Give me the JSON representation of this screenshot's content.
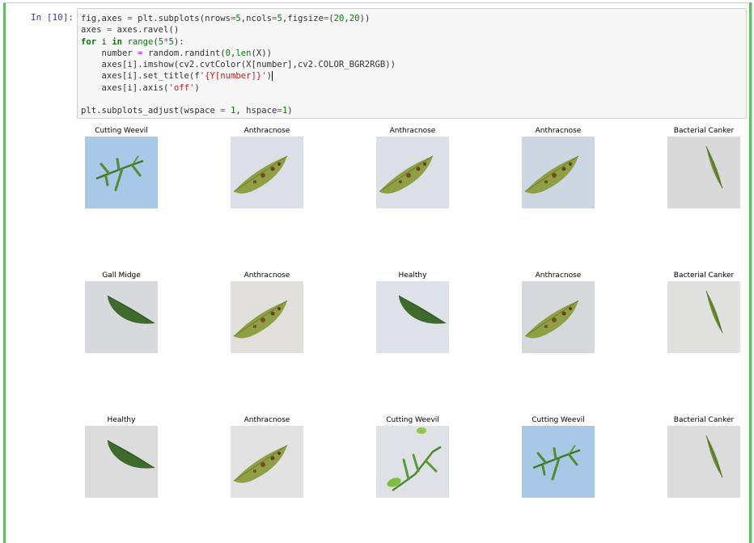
{
  "cell": {
    "prompt": "In [10]:",
    "code_lines": [
      "fig,axes = plt.subplots(nrows=5,ncols=5,figsize=(20,20))",
      "axes = axes.ravel()",
      "for i in range(5*5):",
      "    number = random.randint(0,len(X))",
      "    axes[i].imshow(cv2.cvtColor(X[number],cv2.COLOR_BGR2RGB))",
      "    axes[i].set_title(f'{Y[number]}')",
      "    axes[i].axis('off')",
      "",
      "plt.subplots_adjust(wspace = 1, hspace=1)"
    ]
  },
  "output": {
    "subplots": [
      {
        "title": "Cutting Weevil",
        "image": "twig-on-blue",
        "bg": "#a9c7e6"
      },
      {
        "title": "Anthracnose",
        "image": "leaf-spotted",
        "bg": "#dcdfe5"
      },
      {
        "title": "Anthracnose",
        "image": "leaf-spotted",
        "bg": "#dddfe6"
      },
      {
        "title": "Anthracnose",
        "image": "leaf-spotted",
        "bg": "#cdd7e3"
      },
      {
        "title": "Bacterial Canker",
        "image": "leaf-narrow",
        "bg": "#d9d9d9"
      },
      {
        "title": "Gall Midge",
        "image": "leaf-green",
        "bg": "#d8d9dc"
      },
      {
        "title": "Anthracnose",
        "image": "leaf-spotted",
        "bg": "#e1e0dd"
      },
      {
        "title": "Healthy",
        "image": "leaf-green",
        "bg": "#dfe2e8"
      },
      {
        "title": "Anthracnose",
        "image": "leaf-spotted",
        "bg": "#d6d8dc"
      },
      {
        "title": "Bacterial Canker",
        "image": "leaf-narrow",
        "bg": "#e0e0de"
      },
      {
        "title": "Healthy",
        "image": "leaf-green",
        "bg": "#dcdcdc"
      },
      {
        "title": "Anthracnose",
        "image": "leaf-spotted",
        "bg": "#e2e2e2"
      },
      {
        "title": "Cutting Weevil",
        "image": "twig-on-white",
        "bg": "#dfe1e6"
      },
      {
        "title": "Cutting Weevil",
        "image": "twig-on-blue",
        "bg": "#a9c7e6"
      },
      {
        "title": "Bacterial Canker",
        "image": "leaf-narrow",
        "bg": "#dcdcdc"
      }
    ]
  }
}
